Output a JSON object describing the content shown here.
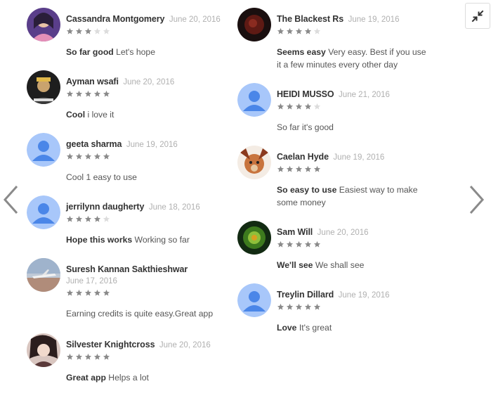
{
  "colors": {
    "star_on": "#8a8a8a",
    "star_off": "#dcdcdc",
    "default_avatar_bg": "#a8c7fa",
    "default_avatar_fg": "#4a86e8"
  },
  "controls": {
    "collapse_icon": "collapse-arrows-icon",
    "prev_icon": "chevron-left-icon",
    "next_icon": "chevron-right-icon"
  },
  "reviews_left": [
    {
      "author": "Cassandra Montgomery",
      "date": "June 20, 2016",
      "rating": 3,
      "title": "So far good",
      "body": "Let's hope",
      "avatar": "photo-woman"
    },
    {
      "author": "Ayman wsafi",
      "date": "June 20, 2016",
      "rating": 5,
      "title": "Cool",
      "body": "i love it",
      "avatar": "photo-dark"
    },
    {
      "author": "geeta sharma",
      "date": "June 19, 2016",
      "rating": 5,
      "title": "",
      "body": "Cool 1 easy to use",
      "avatar": "default"
    },
    {
      "author": "jerrilynn daugherty",
      "date": "June 18, 2016",
      "rating": 4,
      "title": "Hope this works",
      "body": "Working so far",
      "avatar": "default"
    },
    {
      "author": "Suresh Kannan Sakthieshwar",
      "date": "June 17, 2016",
      "rating": 5,
      "title": "",
      "body": "Earning credits is quite easy.Great app",
      "avatar": "photo-plane"
    },
    {
      "author": "Silvester Knightcross",
      "date": "June 20, 2016",
      "rating": 5,
      "title": "Great app",
      "body": "Helps a lot",
      "avatar": "photo-anime"
    }
  ],
  "reviews_right": [
    {
      "author": "The Blackest Rs",
      "date": "June 19, 2016",
      "rating": 4,
      "title": "Seems easy",
      "body": "Very easy. Best if you use it a few minutes every other day",
      "avatar": "photo-dark-red"
    },
    {
      "author": "HEIDI MUSSO",
      "date": "June 21, 2016",
      "rating": 4,
      "title": "",
      "body": "So far it's good",
      "avatar": "default"
    },
    {
      "author": "Caelan Hyde",
      "date": "June 19, 2016",
      "rating": 5,
      "title": "So easy to use",
      "body": "Easiest way to make some money",
      "avatar": "photo-cartoon"
    },
    {
      "author": "Sam Will",
      "date": "June 20, 2016",
      "rating": 5,
      "title": "We'll see",
      "body": "We shall see",
      "avatar": "photo-green"
    },
    {
      "author": "Treylin Dillard",
      "date": "June 19, 2016",
      "rating": 5,
      "title": "Love",
      "body": "It's great",
      "avatar": "default"
    }
  ]
}
